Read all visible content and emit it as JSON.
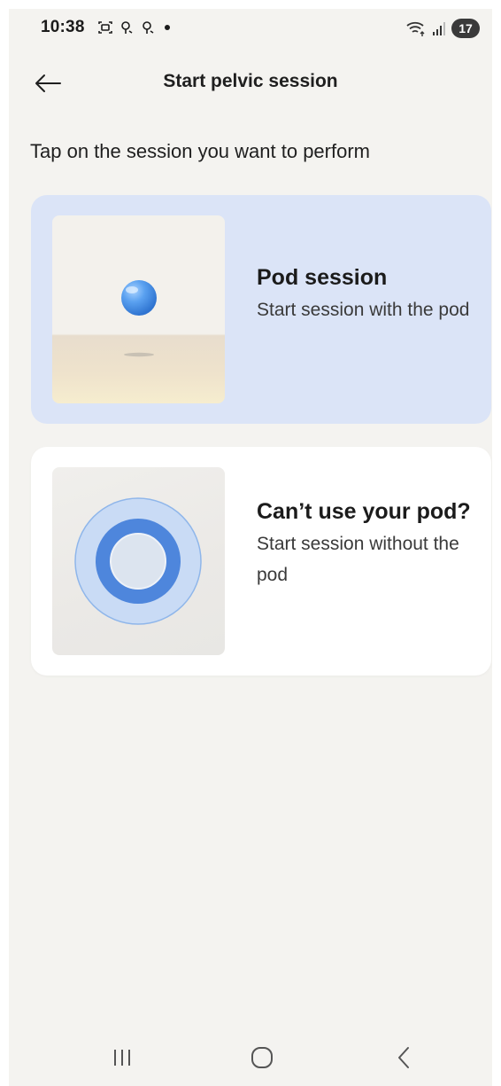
{
  "status_bar": {
    "time": "10:38",
    "battery": "17",
    "icons": [
      "screenshot-icon",
      "hotspot-icon",
      "hotspot-icon",
      "dot-icon",
      "wifi-icon",
      "signal-icon"
    ]
  },
  "header": {
    "title": "Start pelvic session",
    "back_icon": "arrow-left-icon"
  },
  "instruction": "Tap on the session you want to perform",
  "cards": [
    {
      "title": "Pod session",
      "subtitle": "Start session with the pod",
      "background": "#dbe4f7"
    },
    {
      "title": "Can’t use your pod?",
      "subtitle": "Start session without the pod",
      "background": "#ffffff"
    }
  ],
  "nav": {
    "icons": [
      "recent-apps-icon",
      "home-icon",
      "back-icon"
    ]
  },
  "colors": {
    "background": "#f4f3f0",
    "accent_blue": "#4e86dc",
    "pod_card": "#dbe4f7"
  }
}
